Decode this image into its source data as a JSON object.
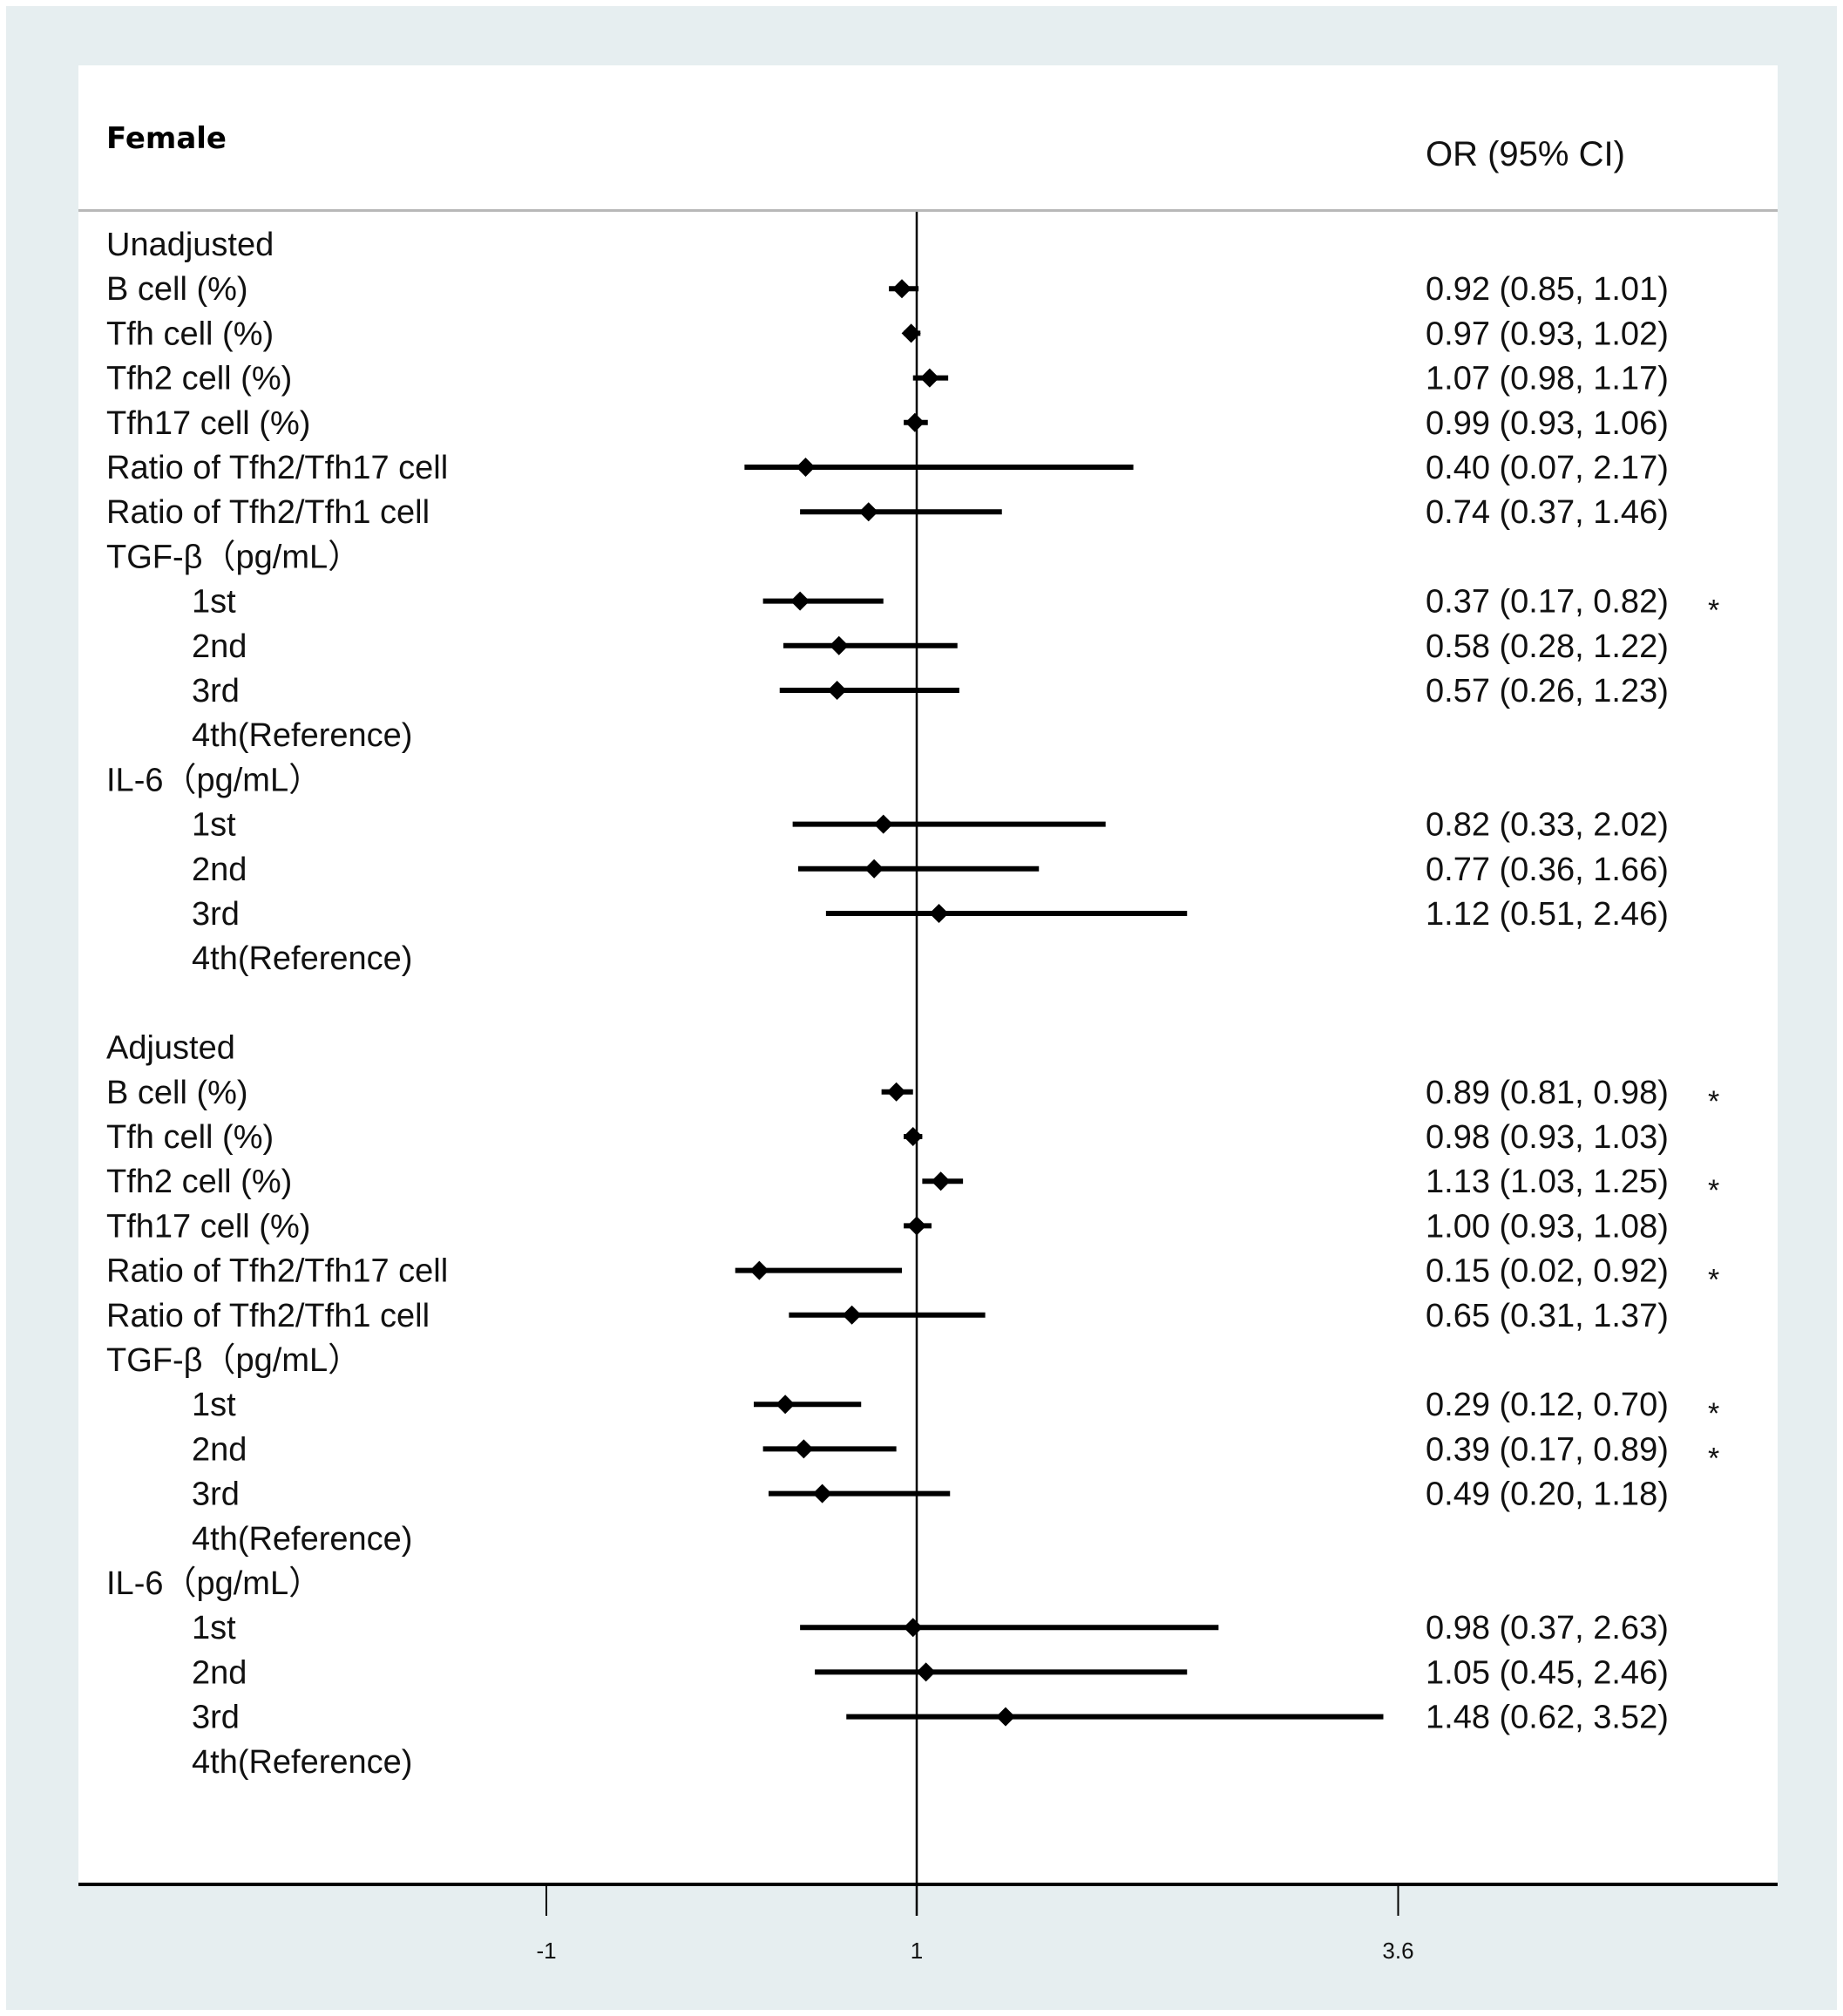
{
  "chart_data": {
    "type": "forest",
    "title": "Female",
    "column_header": "OR (95% CI)",
    "reference_value": 1,
    "xlim": [
      -1.2,
      4.5
    ],
    "x_ticks": [
      {
        "value": -1,
        "label": "-1"
      },
      {
        "value": 1,
        "label": "1"
      },
      {
        "value": 3.6,
        "label": "3.6"
      }
    ],
    "significance_marker": "*",
    "rows": [
      {
        "label": "Unadjusted",
        "indent": 0,
        "kind": "section"
      },
      {
        "label": "B cell (%)",
        "indent": 0,
        "or": 0.92,
        "lo": 0.85,
        "hi": 1.01,
        "text": "0.92 (0.85, 1.01)",
        "sig": false
      },
      {
        "label": "Tfh cell (%)",
        "indent": 0,
        "or": 0.97,
        "lo": 0.93,
        "hi": 1.02,
        "text": "0.97 (0.93, 1.02)",
        "sig": false
      },
      {
        "label": "Tfh2 cell (%)",
        "indent": 0,
        "or": 1.07,
        "lo": 0.98,
        "hi": 1.17,
        "text": "1.07 (0.98, 1.17)",
        "sig": false
      },
      {
        "label": "Tfh17 cell (%)",
        "indent": 0,
        "or": 0.99,
        "lo": 0.93,
        "hi": 1.06,
        "text": "0.99 (0.93, 1.06)",
        "sig": false
      },
      {
        "label": "Ratio of Tfh2/Tfh17 cell",
        "indent": 0,
        "or": 0.4,
        "lo": 0.07,
        "hi": 2.17,
        "text": "0.40 (0.07, 2.17)",
        "sig": false
      },
      {
        "label": "Ratio of Tfh2/Tfh1 cell",
        "indent": 0,
        "or": 0.74,
        "lo": 0.37,
        "hi": 1.46,
        "text": "0.74 (0.37, 1.46)",
        "sig": false
      },
      {
        "label": "TGF-β（pg/mL）",
        "indent": 0,
        "kind": "group"
      },
      {
        "label": "1st",
        "indent": 1,
        "or": 0.37,
        "lo": 0.17,
        "hi": 0.82,
        "text": "0.37 (0.17, 0.82)",
        "sig": true
      },
      {
        "label": "2nd",
        "indent": 1,
        "or": 0.58,
        "lo": 0.28,
        "hi": 1.22,
        "text": "0.58 (0.28, 1.22)",
        "sig": false
      },
      {
        "label": "3rd",
        "indent": 1,
        "or": 0.57,
        "lo": 0.26,
        "hi": 1.23,
        "text": "0.57 (0.26, 1.23)",
        "sig": false
      },
      {
        "label": "4th(Reference)",
        "indent": 1,
        "kind": "reference"
      },
      {
        "label": "IL-6（pg/mL）",
        "indent": 0,
        "kind": "group"
      },
      {
        "label": "1st",
        "indent": 1,
        "or": 0.82,
        "lo": 0.33,
        "hi": 2.02,
        "text": "0.82 (0.33, 2.02)",
        "sig": false
      },
      {
        "label": "2nd",
        "indent": 1,
        "or": 0.77,
        "lo": 0.36,
        "hi": 1.66,
        "text": "0.77 (0.36, 1.66)",
        "sig": false
      },
      {
        "label": "3rd",
        "indent": 1,
        "or": 1.12,
        "lo": 0.51,
        "hi": 2.46,
        "text": "1.12 (0.51, 2.46)",
        "sig": false
      },
      {
        "label": "4th(Reference)",
        "indent": 1,
        "kind": "reference"
      },
      {
        "label": "",
        "indent": 0,
        "kind": "spacer"
      },
      {
        "label": "Adjusted",
        "indent": 0,
        "kind": "section"
      },
      {
        "label": "B cell (%)",
        "indent": 0,
        "or": 0.89,
        "lo": 0.81,
        "hi": 0.98,
        "text": "0.89 (0.81, 0.98)",
        "sig": true
      },
      {
        "label": "Tfh cell (%)",
        "indent": 0,
        "or": 0.98,
        "lo": 0.93,
        "hi": 1.03,
        "text": "0.98 (0.93, 1.03)",
        "sig": false
      },
      {
        "label": "Tfh2 cell (%)",
        "indent": 0,
        "or": 1.13,
        "lo": 1.03,
        "hi": 1.25,
        "text": "1.13 (1.03, 1.25)",
        "sig": true
      },
      {
        "label": "Tfh17 cell (%)",
        "indent": 0,
        "or": 1.0,
        "lo": 0.93,
        "hi": 1.08,
        "text": "1.00 (0.93, 1.08)",
        "sig": false
      },
      {
        "label": "Ratio of Tfh2/Tfh17 cell",
        "indent": 0,
        "or": 0.15,
        "lo": 0.02,
        "hi": 0.92,
        "text": "0.15 (0.02, 0.92)",
        "sig": true
      },
      {
        "label": "Ratio of Tfh2/Tfh1 cell",
        "indent": 0,
        "or": 0.65,
        "lo": 0.31,
        "hi": 1.37,
        "text": "0.65 (0.31, 1.37)",
        "sig": false
      },
      {
        "label": "TGF-β（pg/mL）",
        "indent": 0,
        "kind": "group"
      },
      {
        "label": "1st",
        "indent": 1,
        "or": 0.29,
        "lo": 0.12,
        "hi": 0.7,
        "text": "0.29 (0.12, 0.70)",
        "sig": true
      },
      {
        "label": "2nd",
        "indent": 1,
        "or": 0.39,
        "lo": 0.17,
        "hi": 0.89,
        "text": "0.39 (0.17, 0.89)",
        "sig": true
      },
      {
        "label": "3rd",
        "indent": 1,
        "or": 0.49,
        "lo": 0.2,
        "hi": 1.18,
        "text": "0.49 (0.20, 1.18)",
        "sig": false
      },
      {
        "label": "4th(Reference)",
        "indent": 1,
        "kind": "reference"
      },
      {
        "label": "IL-6（pg/mL）",
        "indent": 0,
        "kind": "group"
      },
      {
        "label": "1st",
        "indent": 1,
        "or": 0.98,
        "lo": 0.37,
        "hi": 2.63,
        "text": "0.98 (0.37, 2.63)",
        "sig": false
      },
      {
        "label": "2nd",
        "indent": 1,
        "or": 1.05,
        "lo": 0.45,
        "hi": 2.46,
        "text": "1.05 (0.45, 2.46)",
        "sig": false
      },
      {
        "label": "3rd",
        "indent": 1,
        "or": 1.48,
        "lo": 0.62,
        "hi": 3.52,
        "text": "1.48 (0.62, 3.52)",
        "sig": false
      },
      {
        "label": "4th(Reference)",
        "indent": 1,
        "kind": "reference"
      }
    ]
  }
}
